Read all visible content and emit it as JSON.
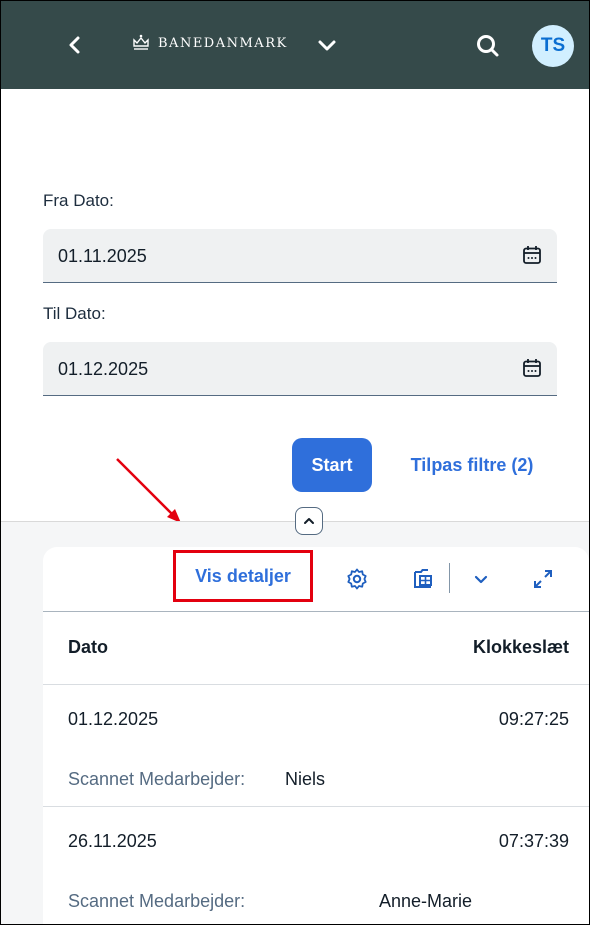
{
  "shellbar": {
    "logo_text": "BANEDANMARK",
    "avatar_initials": "TS",
    "background": "#354a4a"
  },
  "filters": {
    "from_label": "Fra Dato:",
    "from_value": "01.11.2025",
    "to_label": "Til Dato:",
    "to_value": "01.12.2025",
    "start_label": "Start",
    "adapt_label": "Tilpas filtre (2)"
  },
  "table": {
    "toolbar": {
      "details_label": "Vis detaljer"
    },
    "columns": [
      "Dato",
      "Klokkeslæt"
    ],
    "rows": [
      {
        "date": "01.12.2025",
        "time": "09:27:25",
        "employee_label": "Scannet Medarbejder:",
        "employee": "Niels"
      },
      {
        "date": "26.11.2025",
        "time": "07:37:39",
        "employee_label": "Scannet Medarbejder:",
        "employee": "Anne-Marie"
      }
    ]
  },
  "colors": {
    "accent": "#2f6fdb",
    "highlight": "#e3000f",
    "avatar_bg": "#d1efff"
  },
  "icons": [
    "back-icon",
    "crown-logo-icon",
    "menu-chevron-icon",
    "search-icon",
    "calendar-icon",
    "collapse-icon",
    "settings-icon",
    "export-icon",
    "chevron-down-icon",
    "fullscreen-icon",
    "annotation-arrow"
  ]
}
